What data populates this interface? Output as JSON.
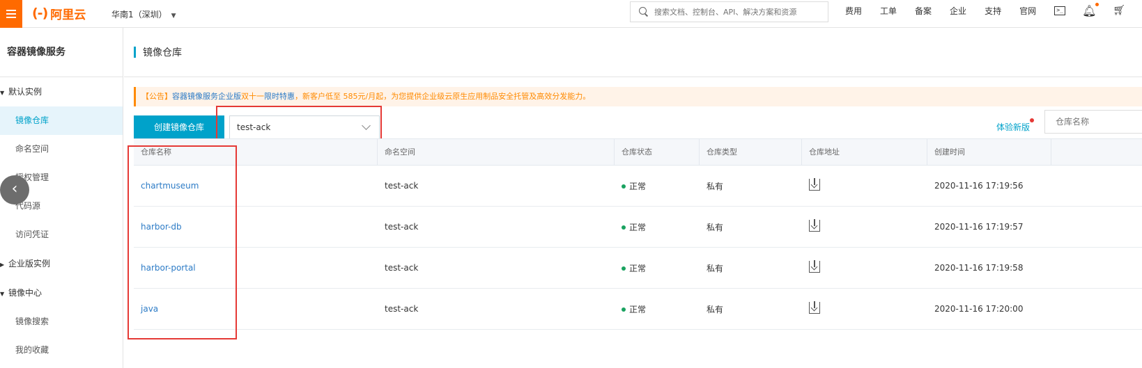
{
  "topbar": {
    "logo_mark": "(-)",
    "logo_text": "阿里云",
    "region": "华南1（深圳）",
    "search_placeholder": "搜索文档、控制台、API、解决方案和资源",
    "nav": [
      "费用",
      "工单",
      "备案",
      "企业",
      "支持",
      "官网"
    ]
  },
  "sidebar": {
    "title": "容器镜像服务",
    "groups": [
      {
        "label": "默认实例",
        "expanded": true
      },
      {
        "label": "企业版实例",
        "expanded": false
      },
      {
        "label": "镜像中心",
        "expanded": true
      }
    ],
    "items": [
      "镜像仓库",
      "命名空间",
      "授权管理",
      "代码源",
      "访问凭证",
      "镜像搜索",
      "我的收藏"
    ],
    "active": "镜像仓库"
  },
  "page": {
    "title": "镜像仓库",
    "notice_prefix": "【公告】",
    "notice_link1": "容器镜像服务企业版",
    "notice_mid": "双十一",
    "notice_link2": "限时特惠",
    "notice_rest": "，新客户低至 585元/月起，为您提供企业级云原生应用制品安全托管及高效分发能力。",
    "create_button": "创建镜像仓库",
    "namespace_selected": "test-ack",
    "try_new": "体验新版",
    "filter_placeholder": "仓库名称"
  },
  "table": {
    "headers": [
      "仓库名称",
      "命名空间",
      "仓库状态",
      "仓库类型",
      "仓库地址",
      "创建时间"
    ],
    "rows": [
      {
        "name": "chartmuseum",
        "namespace": "test-ack",
        "status": "正常",
        "type": "私有",
        "created": "2020-11-16 17:19:56"
      },
      {
        "name": "harbor-db",
        "namespace": "test-ack",
        "status": "正常",
        "type": "私有",
        "created": "2020-11-16 17:19:57"
      },
      {
        "name": "harbor-portal",
        "namespace": "test-ack",
        "status": "正常",
        "type": "私有",
        "created": "2020-11-16 17:19:58"
      },
      {
        "name": "java",
        "namespace": "test-ack",
        "status": "正常",
        "type": "私有",
        "created": "2020-11-16 17:20:00"
      }
    ]
  },
  "colors": {
    "brand": "#ff6a00",
    "accent": "#00a2ca",
    "link": "#2c7bc6",
    "status_ok": "#1aa260",
    "highlight": "#e53935"
  }
}
